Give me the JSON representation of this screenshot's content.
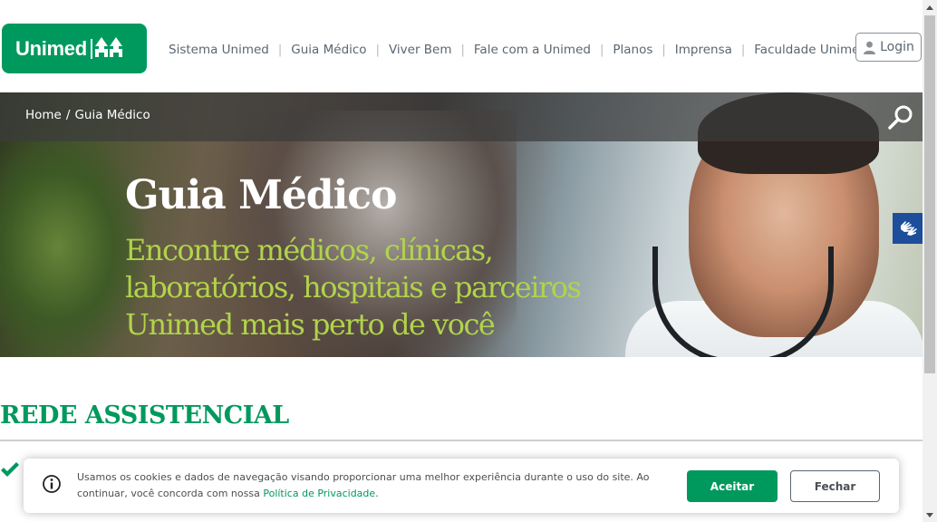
{
  "brand": {
    "name": "Unimed",
    "color": "#00995d"
  },
  "nav": {
    "items": [
      "Sistema Unimed",
      "Guia Médico",
      "Viver Bem",
      "Fale com a Unimed",
      "Planos",
      "Imprensa",
      "Faculdade Unimed"
    ],
    "separator": "|",
    "login_label": "Login"
  },
  "breadcrumb": {
    "items": [
      "Home",
      "Guia Médico"
    ],
    "separator": "/"
  },
  "hero": {
    "title": "Guia Médico",
    "subtitle_lines": [
      "Encontre médicos, clínicas,",
      "laboratórios, hospitais e parceiros",
      "Unimed mais perto de você"
    ],
    "subtitle_color": "#b1d34b"
  },
  "accessibility": {
    "icon": "sign-language-icon",
    "color": "#1d4d9b"
  },
  "section": {
    "title": "REDE ASSISTENCIAL"
  },
  "cookie_banner": {
    "message": "Usamos os cookies e dados de navegação visando proporcionar uma melhor experiência durante o uso do site. Ao continuar, você concorda com nossa ",
    "policy_link": "Política de Privacidade",
    "message_end": ".",
    "accept_label": "Aceitar",
    "close_label": "Fechar"
  }
}
